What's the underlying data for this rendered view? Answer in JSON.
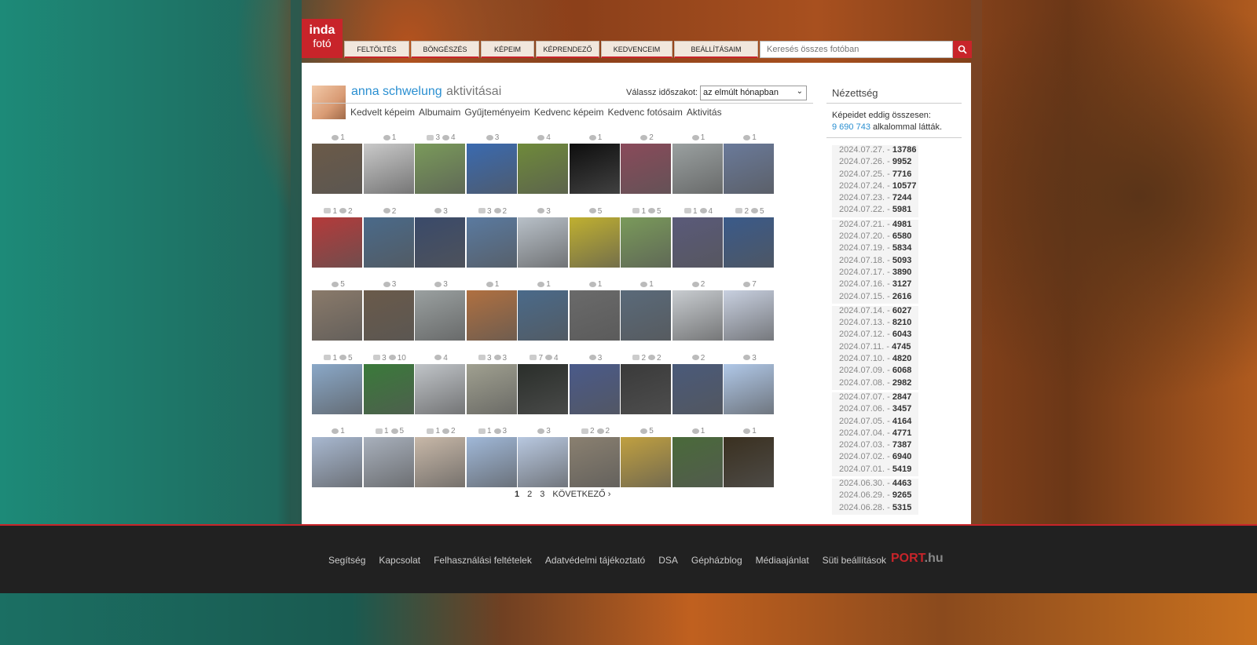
{
  "brand": {
    "line1": "inda",
    "line2": "fotó"
  },
  "nav": [
    "FELTÖLTÉS",
    "BÖNGÉSZÉS",
    "KÉPEIM",
    "KÉPRENDEZŐ",
    "KEDVENCEIM",
    "BEÁLLÍTÁSAIM"
  ],
  "search": {
    "placeholder": "Keresés összes fotóban"
  },
  "profile": {
    "name": "anna schwelung",
    "suffix": "aktivitásai"
  },
  "period": {
    "label": "Válassz időszakot:",
    "selected": "az elmúlt hónapban"
  },
  "sublinks": [
    "Kedvelt képeim",
    "Albumaim",
    "Gyűjteményeim",
    "Kedvenc képeim",
    "Kedvenc fotósaim",
    "Aktivitás"
  ],
  "photo_rows": [
    [
      {
        "c": null,
        "h": 1
      },
      {
        "c": null,
        "h": 1
      },
      {
        "c": 3,
        "h": 4
      },
      {
        "c": null,
        "h": 3
      },
      {
        "c": null,
        "h": 4
      },
      {
        "c": null,
        "h": 1
      },
      {
        "c": null,
        "h": 2
      },
      {
        "c": null,
        "h": 1
      },
      {
        "c": null,
        "h": 1
      }
    ],
    [
      {
        "c": 1,
        "h": 2
      },
      {
        "c": null,
        "h": 2
      },
      {
        "c": null,
        "h": 3
      },
      {
        "c": 3,
        "h": 2
      },
      {
        "c": null,
        "h": 3
      },
      {
        "c": null,
        "h": 5
      },
      {
        "c": 1,
        "h": 5
      },
      {
        "c": 1,
        "h": 4
      },
      {
        "c": 2,
        "h": 5
      }
    ],
    [
      {
        "c": null,
        "h": 5
      },
      {
        "c": null,
        "h": 3
      },
      {
        "c": null,
        "h": 3
      },
      {
        "c": null,
        "h": 1
      },
      {
        "c": null,
        "h": 1
      },
      {
        "c": null,
        "h": 1
      },
      {
        "c": null,
        "h": 1
      },
      {
        "c": null,
        "h": 2
      },
      {
        "c": null,
        "h": 7
      }
    ],
    [
      {
        "c": 1,
        "h": 5
      },
      {
        "c": 3,
        "h": 10
      },
      {
        "c": null,
        "h": 4
      },
      {
        "c": 3,
        "h": 3
      },
      {
        "c": 7,
        "h": 4
      },
      {
        "c": null,
        "h": 3
      },
      {
        "c": 2,
        "h": 2
      },
      {
        "c": null,
        "h": 2
      },
      {
        "c": null,
        "h": 3
      }
    ],
    [
      {
        "c": null,
        "h": 1
      },
      {
        "c": 1,
        "h": 5
      },
      {
        "c": 1,
        "h": 2
      },
      {
        "c": 1,
        "h": 3
      },
      {
        "c": null,
        "h": 3
      },
      {
        "c": 2,
        "h": 2
      },
      {
        "c": null,
        "h": 5
      },
      {
        "c": null,
        "h": 1
      },
      {
        "c": null,
        "h": 1
      }
    ]
  ],
  "thumb_colors": [
    [
      "#6b5a48",
      "#c9c9c9",
      "#7a9a5a",
      "#3a6ab0",
      "#6f8a3a",
      "#0e0e0e",
      "#8a4a5a",
      "#9aa0a0",
      "#6a7a9a"
    ],
    [
      "#b53a3a",
      "#4a6a8a",
      "#3a4a6a",
      "#5a7aa0",
      "#b8c0c8",
      "#c0b030",
      "#7a9a5a",
      "#5a5a7a",
      "#3a5a8a"
    ],
    [
      "#8a7a6a",
      "#6a5a4a",
      "#9aa0a0",
      "#b07040",
      "#4a6a8a",
      "#6a6a6a",
      "#5a6a7a",
      "#c8ccd0",
      "#c8d0e0"
    ],
    [
      "#8aa8c8",
      "#3a7a3a",
      "#c0c4c8",
      "#a0a090",
      "#2a2e2a",
      "#4a5a8a",
      "#3a3a3a",
      "#4a5a7a",
      "#b0c8e8"
    ],
    [
      "#a8b8d0",
      "#a8b0bc",
      "#c8b8a8",
      "#a0b8d8",
      "#b8c8e0",
      "#8a8070",
      "#c0a040",
      "#4a6a3a",
      "#3a3020"
    ]
  ],
  "pager": {
    "pages": [
      "1",
      "2",
      "3"
    ],
    "next": "KÖVETKEZŐ"
  },
  "sidebar": {
    "title": "Nézettség",
    "intro": "Képeidet eddig összesen:",
    "total": "9 690 743",
    "total_suffix": "alkalommal látták.",
    "days": [
      {
        "date": "2024.07.27.",
        "n": "13786"
      },
      {
        "date": "2024.07.26.",
        "n": "9952"
      },
      {
        "date": "2024.07.25.",
        "n": "7716"
      },
      {
        "date": "2024.07.24.",
        "n": "10577"
      },
      {
        "date": "2024.07.23.",
        "n": "7244"
      },
      {
        "date": "2024.07.22.",
        "n": "5981"
      },
      {
        "date": "2024.07.21.",
        "n": "4981"
      },
      {
        "date": "2024.07.20.",
        "n": "6580"
      },
      {
        "date": "2024.07.19.",
        "n": "5834"
      },
      {
        "date": "2024.07.18.",
        "n": "5093"
      },
      {
        "date": "2024.07.17.",
        "n": "3890"
      },
      {
        "date": "2024.07.16.",
        "n": "3127"
      },
      {
        "date": "2024.07.15.",
        "n": "2616"
      },
      {
        "date": "2024.07.14.",
        "n": "6027"
      },
      {
        "date": "2024.07.13.",
        "n": "8210"
      },
      {
        "date": "2024.07.12.",
        "n": "6043"
      },
      {
        "date": "2024.07.11.",
        "n": "4745"
      },
      {
        "date": "2024.07.10.",
        "n": "4820"
      },
      {
        "date": "2024.07.09.",
        "n": "6068"
      },
      {
        "date": "2024.07.08.",
        "n": "2982"
      },
      {
        "date": "2024.07.07.",
        "n": "2847"
      },
      {
        "date": "2024.07.06.",
        "n": "3457"
      },
      {
        "date": "2024.07.05.",
        "n": "4164"
      },
      {
        "date": "2024.07.04.",
        "n": "4771"
      },
      {
        "date": "2024.07.03.",
        "n": "7387"
      },
      {
        "date": "2024.07.02.",
        "n": "6940"
      },
      {
        "date": "2024.07.01.",
        "n": "5419"
      },
      {
        "date": "2024.06.30.",
        "n": "4463"
      },
      {
        "date": "2024.06.29.",
        "n": "9265"
      },
      {
        "date": "2024.06.28.",
        "n": "5315"
      }
    ]
  },
  "footer": {
    "links": [
      "Segítség",
      "Kapcsolat",
      "Felhasználási feltételek",
      "Adatvédelmi tájékoztató",
      "DSA",
      "Gépházblog",
      "Médiaajánlat",
      "Süti beállítások"
    ],
    "brand_main": "PORT",
    "brand_suffix": ".hu"
  }
}
